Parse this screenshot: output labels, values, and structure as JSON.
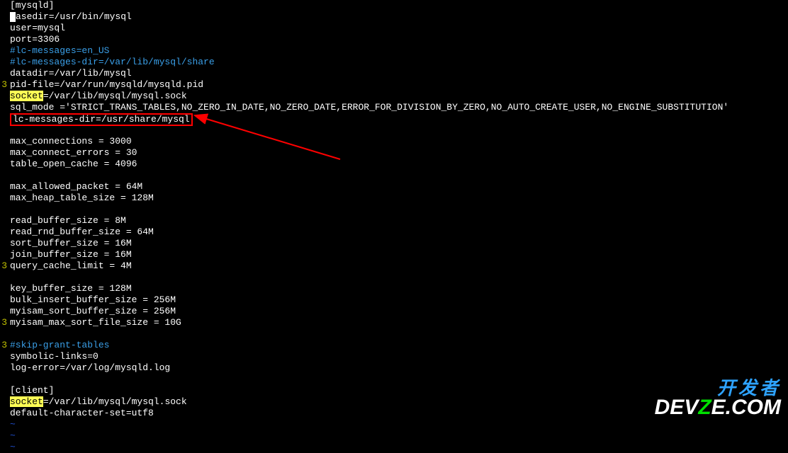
{
  "lines": [
    {
      "num": "",
      "segments": [
        {
          "t": "[mysqld]"
        }
      ]
    },
    {
      "num": "",
      "segments": [
        {
          "cursor": true
        },
        {
          "t": "asedir=/usr/bin/mysql"
        }
      ]
    },
    {
      "num": "",
      "segments": [
        {
          "t": "user=mysql"
        }
      ]
    },
    {
      "num": "",
      "segments": [
        {
          "t": "port=3306"
        }
      ]
    },
    {
      "num": "",
      "segments": [
        {
          "t": "#lc-messages=en_US",
          "cls": "comment"
        }
      ]
    },
    {
      "num": "",
      "segments": [
        {
          "t": "#lc-messages-dir=/var/lib/mysql/share",
          "cls": "comment"
        }
      ]
    },
    {
      "num": "",
      "segments": [
        {
          "t": "datadir=/var/lib/mysql"
        }
      ]
    },
    {
      "num": "3",
      "segments": [
        {
          "t": "pid-file=/var/run/mysqld/mysqld.pid"
        }
      ]
    },
    {
      "num": "",
      "segments": [
        {
          "t": "socket",
          "cls": "hl"
        },
        {
          "t": "=/var/lib/mysql/mysql.sock"
        }
      ]
    },
    {
      "num": "",
      "segments": [
        {
          "t": "sql_mode ='STRICT_TRANS_TABLES,NO_ZERO_IN_DATE,NO_ZERO_DATE,ERROR_FOR_DIVISION_BY_ZERO,NO_AUTO_CREATE_USER,NO_ENGINE_SUBSTITUTION'"
        }
      ]
    },
    {
      "num": "",
      "segments": [
        {
          "t": "lc-messages-dir=/usr/share/mysql",
          "boxed": true
        }
      ]
    },
    {
      "num": "",
      "segments": []
    },
    {
      "num": "",
      "segments": [
        {
          "t": "max_connections = 3000"
        }
      ]
    },
    {
      "num": "",
      "segments": [
        {
          "t": "max_connect_errors = 30"
        }
      ]
    },
    {
      "num": "",
      "segments": [
        {
          "t": "table_open_cache = 4096"
        }
      ]
    },
    {
      "num": "",
      "segments": []
    },
    {
      "num": "",
      "segments": [
        {
          "t": "max_allowed_packet = 64M"
        }
      ]
    },
    {
      "num": "",
      "segments": [
        {
          "t": "max_heap_table_size = 128M"
        }
      ]
    },
    {
      "num": "",
      "segments": []
    },
    {
      "num": "",
      "segments": [
        {
          "t": "read_buffer_size = 8M"
        }
      ]
    },
    {
      "num": "",
      "segments": [
        {
          "t": "read_rnd_buffer_size = 64M"
        }
      ]
    },
    {
      "num": "",
      "segments": [
        {
          "t": "sort_buffer_size = 16M"
        }
      ]
    },
    {
      "num": "",
      "segments": [
        {
          "t": "join_buffer_size = 16M"
        }
      ]
    },
    {
      "num": "3",
      "segments": [
        {
          "t": "query_cache_limit = 4M"
        }
      ]
    },
    {
      "num": "",
      "segments": []
    },
    {
      "num": "",
      "segments": [
        {
          "t": "key_buffer_size = 128M"
        }
      ]
    },
    {
      "num": "",
      "segments": [
        {
          "t": "bulk_insert_buffer_size = 256M"
        }
      ]
    },
    {
      "num": "",
      "segments": [
        {
          "t": "myisam_sort_buffer_size = 256M"
        }
      ]
    },
    {
      "num": "3",
      "segments": [
        {
          "t": "myisam_max_sort_file_size = 10G"
        }
      ]
    },
    {
      "num": "",
      "segments": []
    },
    {
      "num": "3",
      "segments": [
        {
          "t": "#skip-grant-tables",
          "cls": "comment"
        }
      ]
    },
    {
      "num": "",
      "segments": [
        {
          "t": "symbolic-links=0"
        }
      ]
    },
    {
      "num": "",
      "segments": [
        {
          "t": "log-error=/var/log/mysqld.log"
        }
      ]
    },
    {
      "num": "",
      "segments": []
    },
    {
      "num": "",
      "segments": [
        {
          "t": "[client]"
        }
      ]
    },
    {
      "num": "",
      "segments": [
        {
          "t": "socket",
          "cls": "hl"
        },
        {
          "t": "=/var/lib/mysql/mysql.sock"
        }
      ]
    },
    {
      "num": "",
      "segments": [
        {
          "t": "default-character-set=utf8"
        }
      ]
    }
  ],
  "tildes": [
    "~",
    "~",
    "~"
  ],
  "watermark": {
    "line1": "开发者",
    "line2_a": "DEV",
    "line2_b": "Z",
    "line2_c": "E.COM"
  }
}
